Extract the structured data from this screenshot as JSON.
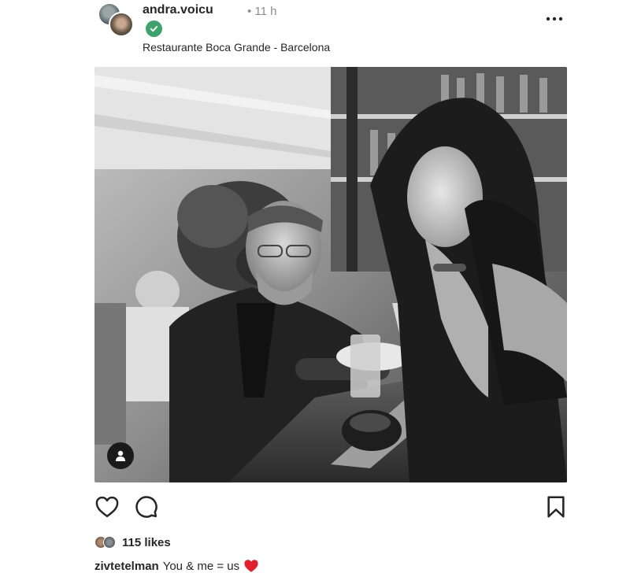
{
  "post": {
    "username": "andra.voicu",
    "time": "• 11 h",
    "location": "Restaurante Boca Grande - Barcelona",
    "verified_icon": "verified-check-icon",
    "more_icon": "more-horizontal-icon"
  },
  "photo": {
    "tag_icon": "user-tag-icon"
  },
  "actions": {
    "like_icon": "heart-outline-icon",
    "comment_icon": "comment-bubble-icon",
    "save_icon": "bookmark-icon"
  },
  "likes": {
    "count_text": "115 likes"
  },
  "caption": {
    "username": "zivtetelman",
    "text": "You & me = us",
    "emoji_icon": "red-heart-icon"
  },
  "colors": {
    "verified": "#3fa16d",
    "text": "#262626",
    "muted": "#8e8e8e",
    "heart": "#e0202e"
  }
}
